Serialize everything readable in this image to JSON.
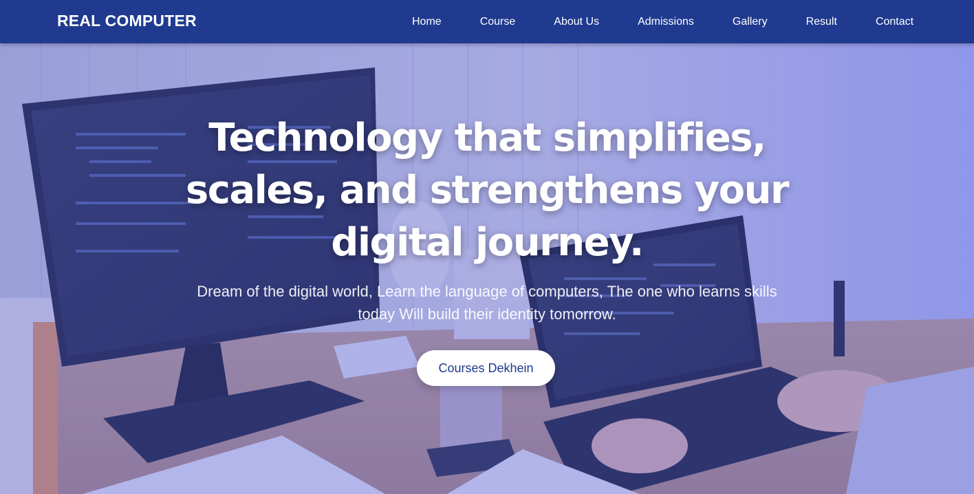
{
  "brand": {
    "name": "REAL COMPUTER"
  },
  "nav": {
    "items": [
      {
        "label": "Home"
      },
      {
        "label": "Course"
      },
      {
        "label": "About Us"
      },
      {
        "label": "Admissions"
      },
      {
        "label": "Gallery"
      },
      {
        "label": "Result"
      },
      {
        "label": "Contact"
      }
    ]
  },
  "hero": {
    "headline": "Technology that simplifies, scales, and strengthens your digital journey.",
    "subtext": "Dream of the digital world, Learn the language of computers, The one who learns skills today Will build their identity tomorrow.",
    "cta_label": "Courses Dekhein"
  },
  "colors": {
    "navbar": "#1f3a8f",
    "overlay": "#4e56dc",
    "cta_text": "#1f3a8f",
    "text": "#ffffff"
  }
}
